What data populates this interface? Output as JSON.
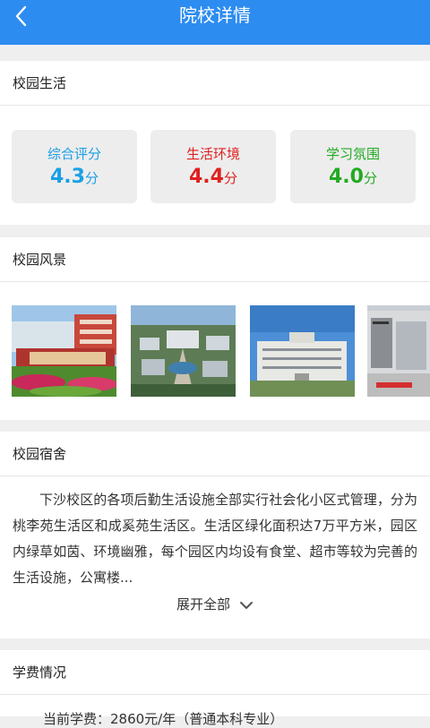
{
  "header": {
    "title": "院校详情"
  },
  "campus_life": {
    "title": "校园生活",
    "cards": [
      {
        "label": "综合评分",
        "score": "4.3",
        "unit": "分",
        "color": "#1aa0e6"
      },
      {
        "label": "生活环境",
        "score": "4.4",
        "unit": "分",
        "color": "#e02020"
      },
      {
        "label": "学习氛围",
        "score": "4.0",
        "unit": "分",
        "color": "#22aa22"
      }
    ]
  },
  "scenery": {
    "title": "校园风景"
  },
  "dorm": {
    "title": "校园宿舍",
    "description": "下沙校区的各项后勤生活设施全部实行社会化小区式管理，分为桃李苑生活区和成奚苑生活区。生活区绿化面积达7万平方米，园区内绿草如茵、环境幽雅，每个园区内均设有食堂、超市等较为完善的生活设施，公寓楼...",
    "expand_label": "展开全部"
  },
  "tuition": {
    "title": "学费情况",
    "line": "当前学费：2860元/年（普通本科专业）"
  }
}
